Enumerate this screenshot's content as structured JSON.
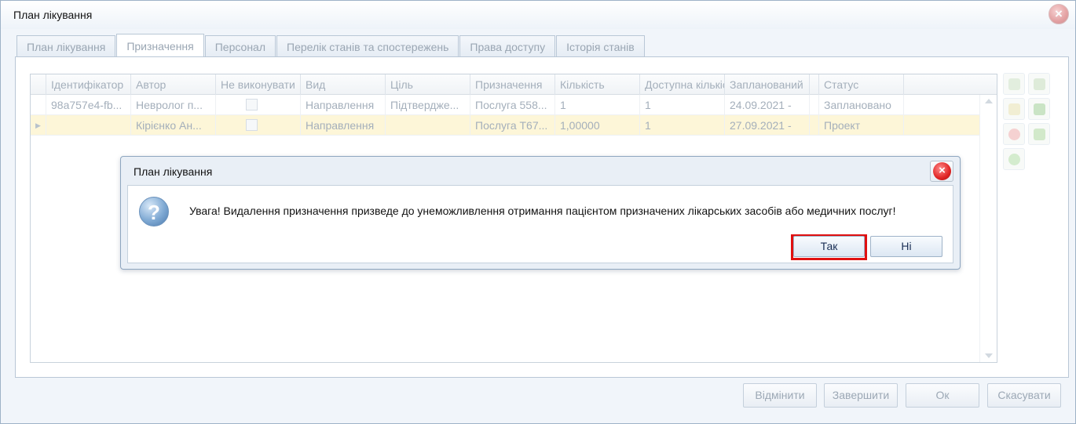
{
  "window": {
    "title": "План лікування"
  },
  "tabs": [
    {
      "label": "План лікування"
    },
    {
      "label": "Призначення"
    },
    {
      "label": "Персонал"
    },
    {
      "label": "Перелік станів та спостережень"
    },
    {
      "label": "Права доступу"
    },
    {
      "label": "Історія станів"
    }
  ],
  "grid": {
    "columns": [
      "Ідентифікатор",
      "Автор",
      "Не виконувати",
      "Вид",
      "Ціль",
      "Призначення",
      "Кількість",
      "Доступна кількість",
      "Запланований",
      "",
      "Статус"
    ],
    "rows": [
      {
        "id": "98a757e4-fb...",
        "author": "Невролог п...",
        "kind": "Направлення",
        "goal": "Підтвердже...",
        "assignment": "Послуга 558...",
        "qty": "1",
        "available": "1",
        "planned": "24.09.2021 -",
        "status": "Заплановано"
      },
      {
        "id": "",
        "author": "Кірієнко Ан...",
        "kind": "Направлення",
        "goal": "",
        "assignment": "Послуга Т67...",
        "qty": "1,00000",
        "available": "1",
        "planned": "27.09.2021 -",
        "status": "Проект"
      }
    ]
  },
  "footer": {
    "cancel_changes": "Відмінити",
    "finish": "Завершити",
    "ok": "Ок",
    "cancel": "Скасувати"
  },
  "dialog": {
    "title": "План лікування",
    "message": "Увага! Видалення призначення призведе до унеможливлення отримання пацієнтом призначених лікарських засобів або медичних послуг!",
    "yes": "Так",
    "no": "Ні",
    "icon": "question-icon",
    "highlight_color": "#e01010"
  }
}
